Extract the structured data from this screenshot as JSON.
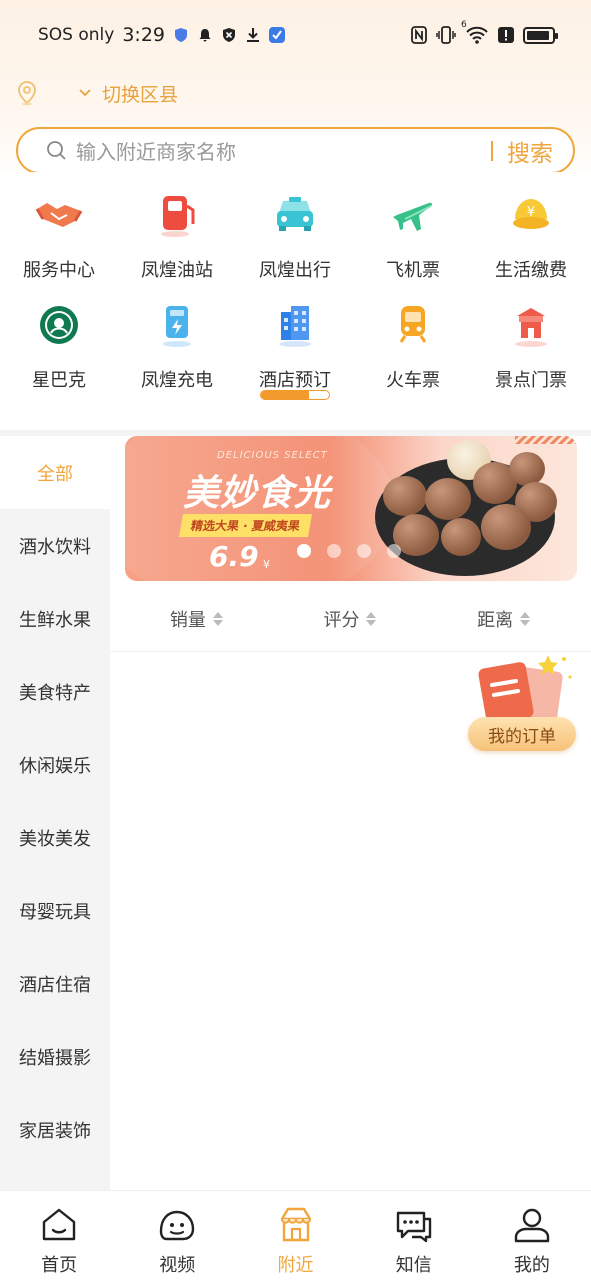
{
  "status_bar": {
    "carrier": "SOS only",
    "time": "3:29",
    "signal_badge": "6"
  },
  "location": {
    "switch_label": "切换区县"
  },
  "search": {
    "placeholder": "输入附近商家名称",
    "button_label": "搜索"
  },
  "categories": [
    {
      "label": "服务中心",
      "icon": "handshake-icon"
    },
    {
      "label": "凤煌油站",
      "icon": "fuel-pump-icon"
    },
    {
      "label": "凤煌出行",
      "icon": "taxi-icon"
    },
    {
      "label": "飞机票",
      "icon": "airplane-icon"
    },
    {
      "label": "生活缴费",
      "icon": "payment-icon"
    },
    {
      "label": "星巴克",
      "icon": "starbucks-icon"
    },
    {
      "label": "凤煌充电",
      "icon": "charging-station-icon"
    },
    {
      "label": "酒店预订",
      "icon": "hotel-icon"
    },
    {
      "label": "火车票",
      "icon": "train-icon"
    },
    {
      "label": "景点门票",
      "icon": "attraction-icon"
    }
  ],
  "category_scroll_progress": 0.7,
  "sidebar": {
    "items": [
      "全部",
      "酒水饮料",
      "生鲜水果",
      "美食特产",
      "休闲娱乐",
      "美妆美发",
      "母婴玩具",
      "酒店住宿",
      "结婚摄影",
      "家居装饰"
    ],
    "active_index": 0
  },
  "banner": {
    "subtitle_en": "DELICIOUS SELECT",
    "title": "美妙食光",
    "tag": "精选大果 · 夏威夷果",
    "price": "6.9",
    "currency": "¥",
    "slide_count": 4,
    "active_slide": 0
  },
  "sort": {
    "items": [
      "销量",
      "评分",
      "距离"
    ]
  },
  "floating": {
    "my_orders": "我的订单"
  },
  "bottom_nav": {
    "items": [
      {
        "label": "首页",
        "icon": "home-icon"
      },
      {
        "label": "视频",
        "icon": "video-icon"
      },
      {
        "label": "附近",
        "icon": "nearby-shop-icon"
      },
      {
        "label": "知信",
        "icon": "message-icon"
      },
      {
        "label": "我的",
        "icon": "profile-icon"
      }
    ],
    "active_index": 2
  },
  "colors": {
    "accent": "#f0a63d",
    "accent_dark": "#f39a2f",
    "text": "#333333",
    "muted": "#999999"
  }
}
